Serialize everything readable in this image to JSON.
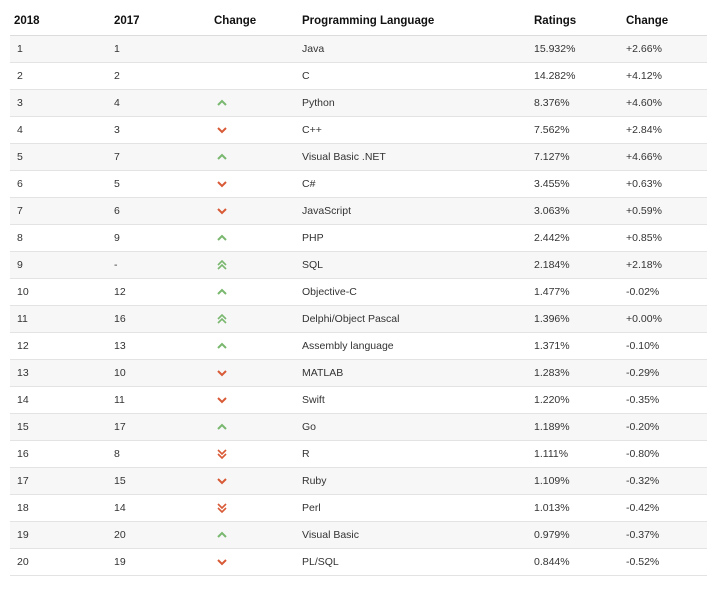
{
  "columns": {
    "year_2018": "2018",
    "year_2017": "2017",
    "change": "Change",
    "language": "Programming Language",
    "ratings": "Ratings",
    "diff": "Change"
  },
  "colors": {
    "up": "#7ab870",
    "down": "#d85a36"
  },
  "rows": [
    {
      "r2018": "1",
      "r2017": "1",
      "trend": "none",
      "lang": "Java",
      "rating": "15.932%",
      "diff": "+2.66%"
    },
    {
      "r2018": "2",
      "r2017": "2",
      "trend": "none",
      "lang": "C",
      "rating": "14.282%",
      "diff": "+4.12%"
    },
    {
      "r2018": "3",
      "r2017": "4",
      "trend": "up",
      "lang": "Python",
      "rating": "8.376%",
      "diff": "+4.60%"
    },
    {
      "r2018": "4",
      "r2017": "3",
      "trend": "down",
      "lang": "C++",
      "rating": "7.562%",
      "diff": "+2.84%"
    },
    {
      "r2018": "5",
      "r2017": "7",
      "trend": "up",
      "lang": "Visual Basic .NET",
      "rating": "7.127%",
      "diff": "+4.66%"
    },
    {
      "r2018": "6",
      "r2017": "5",
      "trend": "down",
      "lang": "C#",
      "rating": "3.455%",
      "diff": "+0.63%"
    },
    {
      "r2018": "7",
      "r2017": "6",
      "trend": "down",
      "lang": "JavaScript",
      "rating": "3.063%",
      "diff": "+0.59%"
    },
    {
      "r2018": "8",
      "r2017": "9",
      "trend": "up",
      "lang": "PHP",
      "rating": "2.442%",
      "diff": "+0.85%"
    },
    {
      "r2018": "9",
      "r2017": "-",
      "trend": "up2",
      "lang": "SQL",
      "rating": "2.184%",
      "diff": "+2.18%"
    },
    {
      "r2018": "10",
      "r2017": "12",
      "trend": "up",
      "lang": "Objective-C",
      "rating": "1.477%",
      "diff": "-0.02%"
    },
    {
      "r2018": "11",
      "r2017": "16",
      "trend": "up2",
      "lang": "Delphi/Object Pascal",
      "rating": "1.396%",
      "diff": "+0.00%"
    },
    {
      "r2018": "12",
      "r2017": "13",
      "trend": "up",
      "lang": "Assembly language",
      "rating": "1.371%",
      "diff": "-0.10%"
    },
    {
      "r2018": "13",
      "r2017": "10",
      "trend": "down",
      "lang": "MATLAB",
      "rating": "1.283%",
      "diff": "-0.29%"
    },
    {
      "r2018": "14",
      "r2017": "11",
      "trend": "down",
      "lang": "Swift",
      "rating": "1.220%",
      "diff": "-0.35%"
    },
    {
      "r2018": "15",
      "r2017": "17",
      "trend": "up",
      "lang": "Go",
      "rating": "1.189%",
      "diff": "-0.20%"
    },
    {
      "r2018": "16",
      "r2017": "8",
      "trend": "down2",
      "lang": "R",
      "rating": "1.111%",
      "diff": "-0.80%"
    },
    {
      "r2018": "17",
      "r2017": "15",
      "trend": "down",
      "lang": "Ruby",
      "rating": "1.109%",
      "diff": "-0.32%"
    },
    {
      "r2018": "18",
      "r2017": "14",
      "trend": "down2",
      "lang": "Perl",
      "rating": "1.013%",
      "diff": "-0.42%"
    },
    {
      "r2018": "19",
      "r2017": "20",
      "trend": "up",
      "lang": "Visual Basic",
      "rating": "0.979%",
      "diff": "-0.37%"
    },
    {
      "r2018": "20",
      "r2017": "19",
      "trend": "down",
      "lang": "PL/SQL",
      "rating": "0.844%",
      "diff": "-0.52%"
    }
  ]
}
